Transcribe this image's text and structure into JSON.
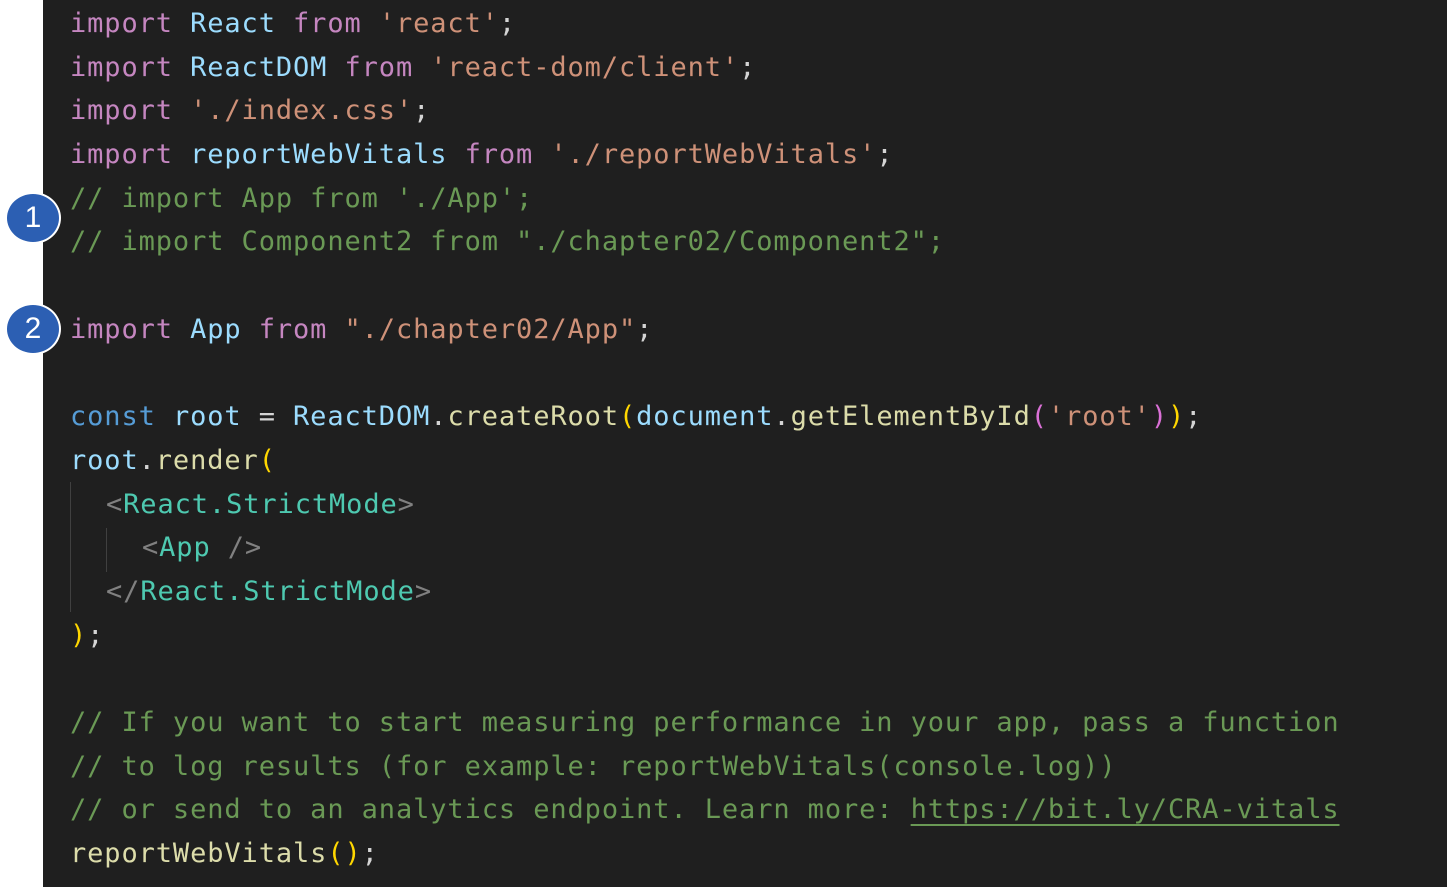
{
  "annotations": {
    "badge_1": "1",
    "badge_2": "2"
  },
  "code": {
    "line1": {
      "kw1": "import",
      "name": "React",
      "kw2": "from",
      "str": "'react'",
      "semi": ";"
    },
    "line2": {
      "kw1": "import",
      "name": "ReactDOM",
      "kw2": "from",
      "str": "'react-dom/client'",
      "semi": ";"
    },
    "line3": {
      "kw1": "import",
      "str": "'./index.css'",
      "semi": ";"
    },
    "line4": {
      "kw1": "import",
      "name": "reportWebVitals",
      "kw2": "from",
      "str": "'./reportWebVitals'",
      "semi": ";"
    },
    "line5": {
      "comment": "// import App from './App';"
    },
    "line6": {
      "comment": "// import Component2 from \"./chapter02/Component2\";"
    },
    "line8": {
      "kw1": "import",
      "name": "App",
      "kw2": "from",
      "str": "\"./chapter02/App\"",
      "semi": ";"
    },
    "line10": {
      "decl": "const",
      "name": "root",
      "eq": " = ",
      "obj": "ReactDOM",
      "dot": ".",
      "fn": "createRoot",
      "p_open": "(",
      "arg_obj": "document",
      "dot2": ".",
      "arg_fn": "getElementById",
      "p2_open": "(",
      "str": "'root'",
      "p2_close": ")",
      "p_close": ")",
      "semi": ";"
    },
    "line11": {
      "obj": "root",
      "dot": ".",
      "fn": "render",
      "p_open": "("
    },
    "line12": {
      "lt": "<",
      "tag": "React.StrictMode",
      "gt": ">"
    },
    "line13": {
      "lt": "<",
      "tag": "App",
      "close": " />"
    },
    "line14": {
      "lt": "</",
      "tag": "React.StrictMode",
      "gt": ">"
    },
    "line15": {
      "p_close": ")",
      "semi": ";"
    },
    "line17": {
      "comment": "// If you want to start measuring performance in your app, pass a function"
    },
    "line18": {
      "comment": "// to log results (for example: reportWebVitals(console.log))"
    },
    "line19": {
      "comment_prefix": "// or send to an analytics endpoint. Learn more: ",
      "link": "https://bit.ly/CRA-vitals"
    },
    "line20": {
      "fn": "reportWebVitals",
      "p_open": "(",
      "p_close": ")",
      "semi": ";"
    }
  },
  "colors": {
    "editor_bg": "#1f1f1f",
    "keyword": "#c586c0",
    "string": "#ce9178",
    "variable": "#9cdcfe",
    "function": "#dcdcaa",
    "comment": "#6a9955",
    "jsx_tag": "#4ec9b0",
    "declaration": "#569cd6",
    "bracket_gold": "#ffd700",
    "bracket_orchid": "#da70d6",
    "bracket_blue": "#179fff",
    "badge_fill": "#2c5fb3"
  }
}
